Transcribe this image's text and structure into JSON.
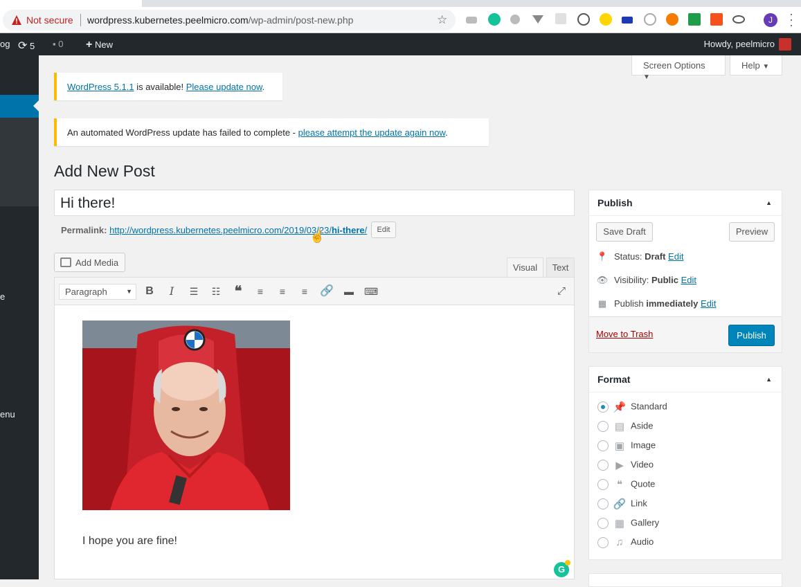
{
  "browser": {
    "security_label": "Not secure",
    "url_host": "wordpress.kubernetes.peelmicro.com",
    "url_path": "/wp-admin/post-new.php",
    "profile_initial": "J"
  },
  "adminbar": {
    "site_fragment": "og",
    "updates_count": "5",
    "comments_count": "0",
    "new_label": "New",
    "howdy": "Howdy, peelmicro"
  },
  "sidebar": {
    "fragment_1": "e",
    "fragment_2": "enu"
  },
  "top_buttons": {
    "screen_options": "Screen Options",
    "help": "Help"
  },
  "notices": [
    {
      "link1": "WordPress 5.1.1",
      "text": " is available! ",
      "link2": "Please update now",
      "end": "."
    },
    {
      "text": "An automated WordPress update has failed to complete - ",
      "link": "please attempt the update again now",
      "end": "."
    }
  ],
  "page_title": "Add New Post",
  "post": {
    "title": "Hi there!",
    "permalink_label": "Permalink:",
    "permalink_base": "http://wordpress.kubernetes.peelmicro.com/2019/03/23/",
    "permalink_slug": "hi-there",
    "permalink_end": "/",
    "edit_label": "Edit",
    "body_text": "I hope you are fine!"
  },
  "editor": {
    "add_media": "Add Media",
    "tab_visual": "Visual",
    "tab_text": "Text",
    "format_select": "Paragraph"
  },
  "publish_box": {
    "title": "Publish",
    "save_draft": "Save Draft",
    "preview": "Preview",
    "status_label": "Status: ",
    "status_value": "Draft",
    "visibility_label": "Visibility: ",
    "visibility_value": "Public",
    "publish_label": "Publish ",
    "publish_value": "immediately",
    "edit": "Edit",
    "move_to_trash": "Move to Trash",
    "publish_button": "Publish"
  },
  "format_box": {
    "title": "Format",
    "options": [
      "Standard",
      "Aside",
      "Image",
      "Video",
      "Quote",
      "Link",
      "Gallery",
      "Audio"
    ],
    "selected": "Standard"
  },
  "colors": {
    "accent": "#0073aa",
    "primary_button": "#0085ba",
    "notice_warning": "#ffb900",
    "trash": "#a00"
  }
}
